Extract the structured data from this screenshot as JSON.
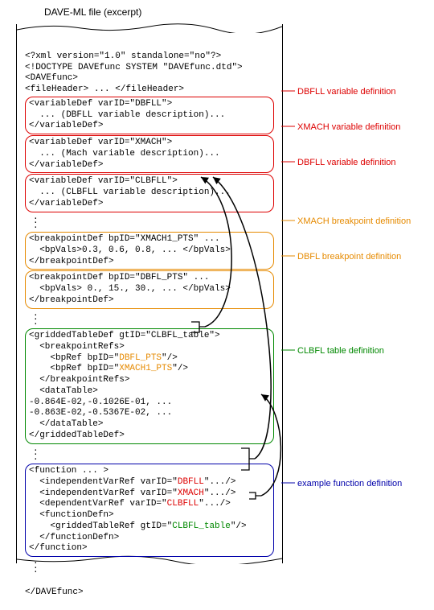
{
  "title": "DAVE-ML file (excerpt)",
  "xml_decl": "<?xml version=\"1.0\" standalone=\"no\"?>",
  "doctype": "<!DOCTYPE DAVEfunc SYSTEM \"DAVEfunc.dtd\">",
  "root_open": "<DAVEfunc>",
  "fileheader": "<fileHeader> ... </fileHeader>",
  "var1_open": "<variableDef varID=\"DBFLL\">",
  "var1_body": "  ... (DBFLL variable description)...",
  "var1_close": "</variableDef>",
  "var2_open": "<variableDef varID=\"XMACH\">",
  "var2_body": "  ... (Mach variable description)...",
  "var2_close": "</variableDef>",
  "var3_open": "<variableDef varID=\"CLBFLL\">",
  "var3_body": "  ... (CLBFLL variable description)...",
  "var3_close": "</variableDef>",
  "bp1_open": "<breakpointDef bpID=\"XMACH1_PTS\" ...",
  "bp1_vals": "  <bpVals>0.3, 0.6, 0.8, ... </bpVals>",
  "bp1_close": "</breakpointDef>",
  "bp2_open": "<breakpointDef bpID=\"DBFL_PTS\" ...",
  "bp2_vals": "  <bpVals> 0., 15., 30., ... </bpVals>",
  "bp2_close": "</breakpointDef>",
  "gt_open": "<griddedTableDef gtID=\"CLBFL_table\">",
  "gt_bprefs_open": "  <breakpointRefs>",
  "gt_bpref1_a": "    <bpRef bpID=\"",
  "gt_bpref1_b": "DBFL_PTS",
  "gt_bpref1_c": "\"/>",
  "gt_bpref2_a": "    <bpRef bpID=\"",
  "gt_bpref2_b": "XMACH1_PTS",
  "gt_bpref2_c": "\"/>",
  "gt_bprefs_close": "  </breakpointRefs>",
  "gt_dt_open": "  <dataTable>",
  "gt_row1": "-0.864E-02,-0.1026E-01, ...",
  "gt_row2": "-0.863E-02,-0.5367E-02, ...",
  "gt_dt_close": "  </dataTable>",
  "gt_close": "</griddedTableDef>",
  "fn_open": "<function ... >",
  "fn_iv1_a": "  <independentVarRef varID=\"",
  "fn_iv1_b": "DBFLL",
  "fn_iv1_c": "\".../>",
  "fn_iv2_a": "  <independentVarRef varID=\"",
  "fn_iv2_b": "XMACH",
  "fn_iv2_c": "\".../>",
  "fn_dv_a": "  <dependentVarRef varID=\"",
  "fn_dv_b": "CLBFLL",
  "fn_dv_c": "\".../>",
  "fn_defn_open": "  <functionDefn>",
  "fn_gtref_a": "    <griddedTableRef gtID=\"",
  "fn_gtref_b": "CLBFL_table",
  "fn_gtref_c": "\"/>",
  "fn_defn_close": "  </functionDefn>",
  "fn_close": "</function>",
  "root_close": "</DAVEfunc>",
  "annot": {
    "var1": "DBFLL variable definition",
    "var2": "XMACH variable definition",
    "var3": "DBFLL variable definition",
    "bp1": "XMACH breakpoint definition",
    "bp2": "DBFL breakpoint definition",
    "gt": "CLBFL table definition",
    "fn": "example function definition"
  }
}
